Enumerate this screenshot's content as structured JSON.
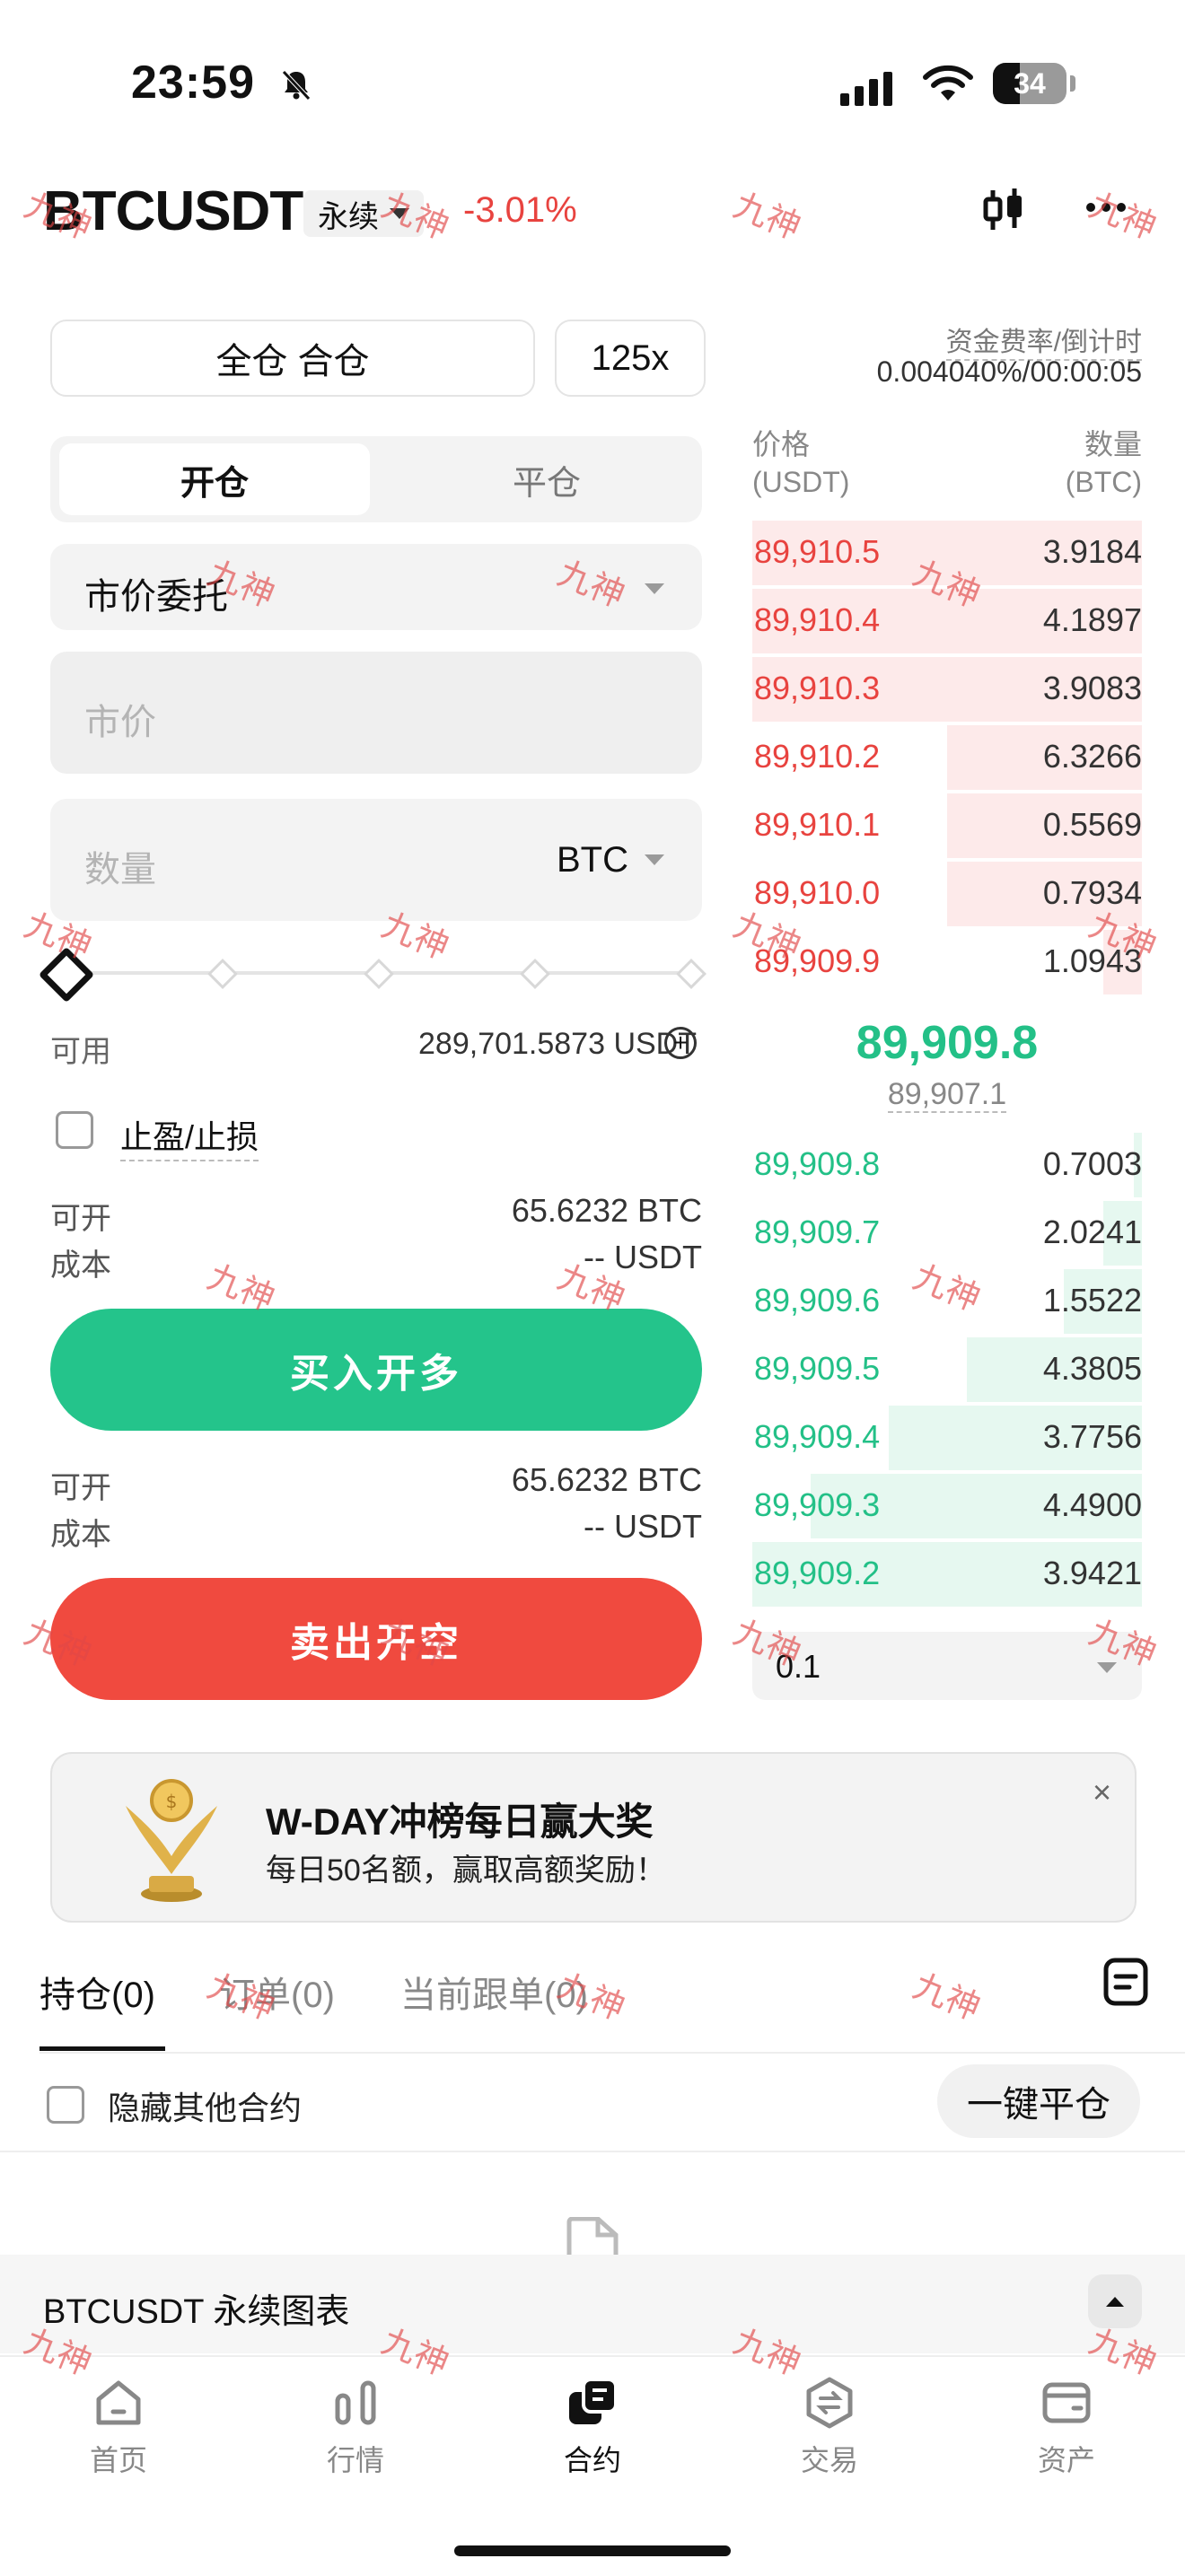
{
  "status_bar": {
    "time": "23:59",
    "battery": "34"
  },
  "header": {
    "pair": "BTCUSDT",
    "contract_type": "永续",
    "change": "-3.01%"
  },
  "order_form": {
    "margin_mode": "全仓 合仓",
    "leverage": "125x",
    "tabs": [
      "开仓",
      "平仓"
    ],
    "order_type": "市价委托",
    "price_placeholder": "市价",
    "quantity_placeholder": "数量",
    "quantity_unit": "BTC",
    "slider_percent": 0,
    "available_label": "可用",
    "available_value": "289,701.5873 USDT",
    "tpsl_label": "止盈/止损",
    "long": {
      "open_label": "可开",
      "open_value": "65.6232 BTC",
      "cost_label": "成本",
      "cost_value": "-- USDT",
      "button": "买入开多"
    },
    "short": {
      "open_label": "可开",
      "open_value": "65.6232 BTC",
      "cost_label": "成本",
      "cost_value": "-- USDT",
      "button": "卖出开空"
    }
  },
  "order_book": {
    "funding_label": "资金费率/倒计时",
    "funding_value": "0.004040%/00:00:05",
    "price_header": "价格",
    "price_unit": "(USDT)",
    "qty_header": "数量",
    "qty_unit": "(BTC)",
    "asks": [
      {
        "price": "89,910.5",
        "qty": "3.9184",
        "depth": 1.0
      },
      {
        "price": "89,910.4",
        "qty": "4.1897",
        "depth": 1.0
      },
      {
        "price": "89,910.3",
        "qty": "3.9083",
        "depth": 1.0
      },
      {
        "price": "89,910.2",
        "qty": "6.3266",
        "depth": 0.5
      },
      {
        "price": "89,910.1",
        "qty": "0.5569",
        "depth": 0.5
      },
      {
        "price": "89,910.0",
        "qty": "0.7934",
        "depth": 0.5
      },
      {
        "price": "89,909.9",
        "qty": "1.0943",
        "depth": 0.1
      }
    ],
    "last_price": "89,909.8",
    "mark_price": "89,907.1",
    "bids": [
      {
        "price": "89,909.8",
        "qty": "0.7003",
        "depth": 0.02
      },
      {
        "price": "89,909.7",
        "qty": "2.0241",
        "depth": 0.1
      },
      {
        "price": "89,909.6",
        "qty": "1.5522",
        "depth": 0.2
      },
      {
        "price": "89,909.5",
        "qty": "4.3805",
        "depth": 0.45
      },
      {
        "price": "89,909.4",
        "qty": "3.7756",
        "depth": 0.65
      },
      {
        "price": "89,909.3",
        "qty": "4.4900",
        "depth": 0.85
      },
      {
        "price": "89,909.2",
        "qty": "3.9421",
        "depth": 1.0
      }
    ],
    "depth_step": "0.1"
  },
  "banner": {
    "title": "W-DAY冲榜每日赢大奖",
    "subtitle": "每日50名额，赢取高额奖励！",
    "close": "×"
  },
  "tabs": [
    "持仓(0)",
    "订单(0)",
    "当前跟单(0)"
  ],
  "positions": {
    "hide_others_label": "隐藏其他合约",
    "close_all": "一键平仓"
  },
  "chart_bar": {
    "label": "BTCUSDT 永续图表"
  },
  "bottom_nav": [
    "首页",
    "行情",
    "合约",
    "交易",
    "资产"
  ],
  "watermark": "九神",
  "colors": {
    "green": "#23c087",
    "red": "#e8433f",
    "long_button": "#24c48b",
    "short_button": "#f04a3f"
  }
}
